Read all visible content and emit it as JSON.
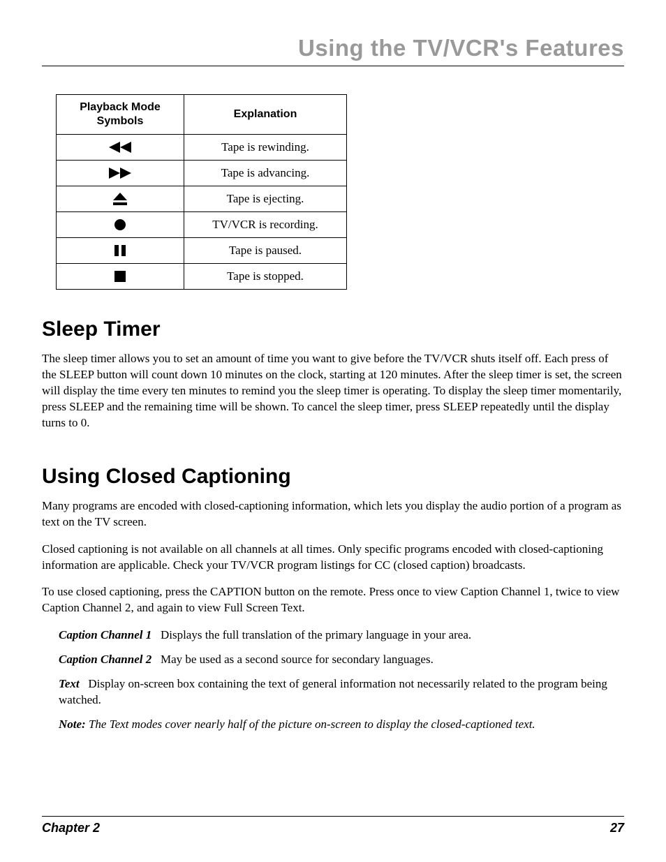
{
  "header": {
    "title": "Using the TV/VCR's Features"
  },
  "table": {
    "head_col1_line1": "Playback Mode",
    "head_col1_line2": "Symbols",
    "head_col2": "Explanation",
    "rows": [
      {
        "icon": "rewind",
        "text": "Tape is rewinding."
      },
      {
        "icon": "advance",
        "text": "Tape is advancing."
      },
      {
        "icon": "eject",
        "text": "Tape is ejecting."
      },
      {
        "icon": "record",
        "text": "TV/VCR is recording."
      },
      {
        "icon": "pause",
        "text": "Tape is paused."
      },
      {
        "icon": "stop",
        "text": "Tape is stopped."
      }
    ]
  },
  "section1": {
    "title": "Sleep Timer",
    "body": "The sleep timer allows you to set an amount of time you want to give before the TV/VCR shuts itself off. Each press of the SLEEP button will count down 10 minutes on the clock, starting at 120 minutes. After the sleep timer is set, the screen will display the time every ten minutes to remind you the sleep timer is operating. To display the sleep timer momentarily, press SLEEP and the remaining time will be shown. To cancel the sleep timer, press SLEEP repeatedly until the display turns to 0."
  },
  "section2": {
    "title": "Using Closed Captioning",
    "p1": "Many programs are encoded with closed-captioning information, which lets you display the audio portion of a program as text on the TV screen.",
    "p2": "Closed captioning is not available on all channels at all times. Only specific programs encoded with closed-captioning information are applicable. Check your TV/VCR program listings for CC (closed caption) broadcasts.",
    "p3": "To use closed captioning, press the CAPTION button on the remote. Press once to view Caption Channel 1, twice to view Caption Channel 2, and again to view Full Screen Text.",
    "defs": [
      {
        "label": "Caption Channel 1",
        "text": "Displays the full translation of the primary language in your area."
      },
      {
        "label": "Caption Channel 2",
        "text": "May be used as a second source for secondary languages."
      },
      {
        "label": "Text",
        "text": "Display on-screen box containing the text of general information not necessarily related to the program being watched."
      }
    ],
    "note_label": "Note:",
    "note_text": "The Text modes cover nearly half of the picture on-screen to display the closed-captioned text."
  },
  "footer": {
    "left": "Chapter 2",
    "right": "27"
  }
}
